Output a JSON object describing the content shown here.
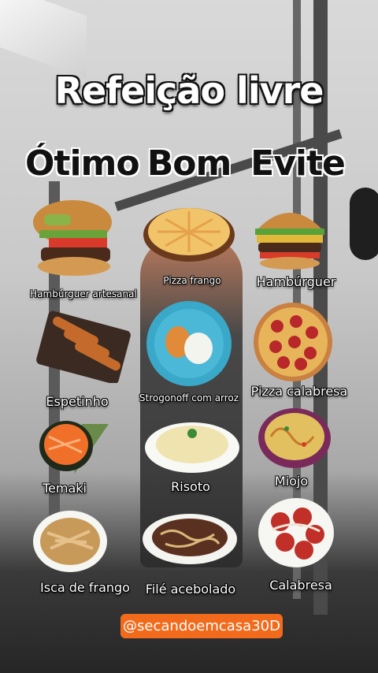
{
  "title": "Refeição livre",
  "columns": [
    "Ótimo",
    "Bom",
    "Evite"
  ],
  "items": [
    {
      "label": "Hambúrguer artesanal"
    },
    {
      "label": "Pizza frango"
    },
    {
      "label": "Hambúrguer"
    },
    {
      "label": "Espetinho"
    },
    {
      "label": "Strogonoff com arroz"
    },
    {
      "label": "Pizza calabresa"
    },
    {
      "label": "Temaki"
    },
    {
      "label": "Risoto"
    },
    {
      "label": "Miojo"
    },
    {
      "label": "Isca de frango"
    },
    {
      "label": "Filé acebolado"
    },
    {
      "label": "Calabresa"
    }
  ],
  "handle": "@secandoemcasa30D"
}
